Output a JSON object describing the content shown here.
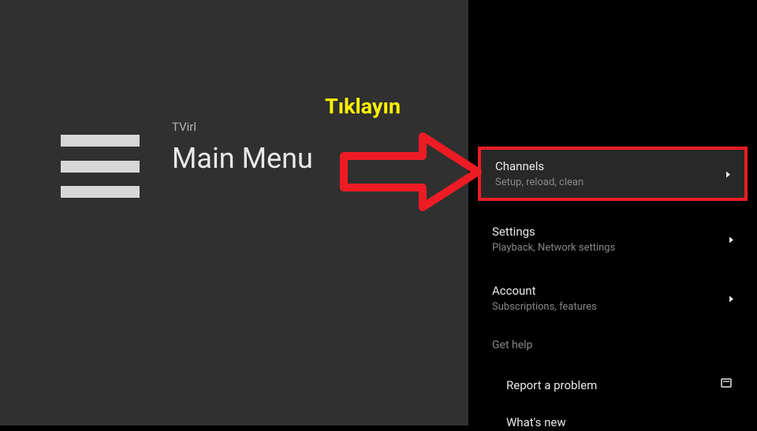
{
  "left": {
    "app_name": "TVirl",
    "title": "Main Menu"
  },
  "menu": {
    "channels": {
      "title": "Channels",
      "subtitle": "Setup, reload, clean"
    },
    "settings": {
      "title": "Settings",
      "subtitle": "Playback, Network settings"
    },
    "account": {
      "title": "Account",
      "subtitle": "Subscriptions, features"
    },
    "help_header": "Get help",
    "report": "Report a problem",
    "whatsnew": "What's new"
  },
  "annotation": {
    "label": "Tıklayın"
  }
}
